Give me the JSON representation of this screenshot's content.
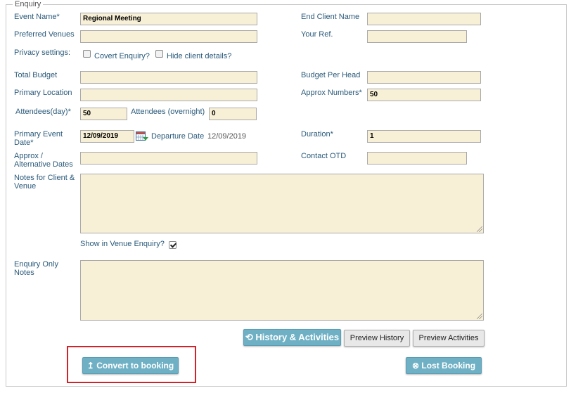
{
  "section": {
    "legend": "Enquiry"
  },
  "fields": {
    "event_name": {
      "label": "Event Name*",
      "value": "Regional Meeting"
    },
    "end_client_name": {
      "label": "End Client Name",
      "value": ""
    },
    "preferred_venues": {
      "label": "Preferred Venues",
      "value": ""
    },
    "your_ref": {
      "label": "Your Ref.",
      "value": ""
    },
    "privacy": {
      "label": "Privacy settings:",
      "covert_enquiry": {
        "label": "Covert Enquiry?",
        "checked": false
      },
      "hide_client_details": {
        "label": "Hide client details?",
        "checked": false
      }
    },
    "total_budget": {
      "label": "Total Budget",
      "value": ""
    },
    "budget_per_head": {
      "label": "Budget Per Head",
      "value": ""
    },
    "primary_location": {
      "label": "Primary Location",
      "value": ""
    },
    "approx_numbers": {
      "label": "Approx Numbers*",
      "value": "50"
    },
    "attendees_day": {
      "label": "Attendees(day)*",
      "value": "50"
    },
    "attendees_overnight": {
      "label": "Attendees (overnight)",
      "value": "0"
    },
    "primary_event_date": {
      "label_line1": "Primary Event",
      "label_line2": "Date*",
      "value": "12/09/2019"
    },
    "departure_date": {
      "label": "Departure Date",
      "value": "12/09/2019"
    },
    "duration": {
      "label": "Duration*",
      "value": "1"
    },
    "approx_dates": {
      "label_line1": "Approx /",
      "label_line2": "Alternative Dates",
      "value": ""
    },
    "contact_otd": {
      "label": "Contact OTD",
      "value": ""
    },
    "notes_client_venue": {
      "label_line1": "Notes for Client &",
      "label_line2": "Venue",
      "value": ""
    },
    "show_in_venue_enquiry": {
      "label": "Show in Venue Enquiry?",
      "checked": true
    },
    "enquiry_only_notes": {
      "label_line1": "Enquiry Only",
      "label_line2": "Notes",
      "value": ""
    }
  },
  "buttons": {
    "history_activities": {
      "label": "History & Activities",
      "icon": "history-icon"
    },
    "preview_history": {
      "label": "Preview History"
    },
    "preview_activities": {
      "label": "Preview Activities"
    },
    "convert_to_booking": {
      "label": "Convert to booking",
      "icon": "upload-arrow-icon"
    },
    "lost_booking": {
      "label": "Lost Booking",
      "icon": "cancel-circle-icon"
    }
  },
  "colors": {
    "input_bg": "#f8f0d6",
    "label": "#2a5a7a",
    "button_teal": "#6fb0c5",
    "highlight": "#d2232a"
  }
}
